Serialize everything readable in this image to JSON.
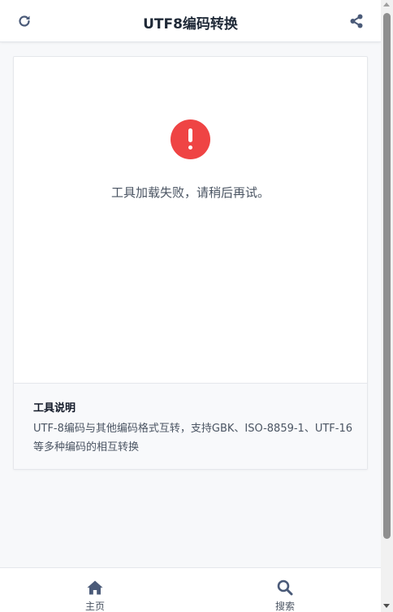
{
  "header": {
    "title": "UTF8编码转换",
    "left_icon": "refresh-icon",
    "right_icon": "share-icon"
  },
  "error": {
    "icon": "exclamation-circle-icon",
    "message": "工具加载失败，请稍后再试。"
  },
  "description": {
    "title": "工具说明",
    "text": "UTF-8编码与其他编码格式互转，支持GBK、ISO-8859-1、UTF-16等多种编码的相互转换"
  },
  "bottom_nav": [
    {
      "label": "主页",
      "icon": "home-icon"
    },
    {
      "label": "搜索",
      "icon": "search-icon"
    }
  ],
  "colors": {
    "accent": "#ef4444",
    "nav_icon": "#4a5a78",
    "text_secondary": "#4b5563"
  }
}
